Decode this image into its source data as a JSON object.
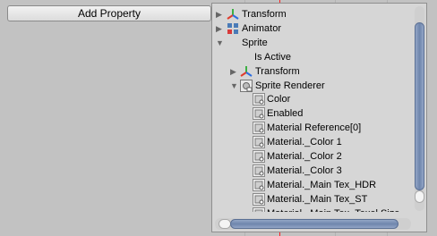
{
  "add_property_label": "Add Property",
  "colors": {
    "timeline_marker": "#ff2020",
    "scrollbar_thumb": "#6f86ad"
  },
  "tree": [
    {
      "label": "Transform",
      "icon": "transform-icon",
      "expand": "collapsed"
    },
    {
      "label": "Animator",
      "icon": "animator-icon",
      "expand": "collapsed"
    },
    {
      "label": "Sprite",
      "icon": "",
      "expand": "expanded"
    },
    {
      "label": "Is Active",
      "icon": "",
      "expand": "none"
    },
    {
      "label": "Transform",
      "icon": "transform-icon",
      "expand": "collapsed"
    },
    {
      "label": "Sprite Renderer",
      "icon": "sprite-renderer-icon",
      "expand": "expanded"
    },
    {
      "label": "Color",
      "icon": "property-icon",
      "expand": "none"
    },
    {
      "label": "Enabled",
      "icon": "property-icon",
      "expand": "none"
    },
    {
      "label": "Material Reference[0]",
      "icon": "property-icon",
      "expand": "none"
    },
    {
      "label": "Material._Color 1",
      "icon": "property-icon",
      "expand": "none"
    },
    {
      "label": "Material._Color 2",
      "icon": "property-icon",
      "expand": "none"
    },
    {
      "label": "Material._Color 3",
      "icon": "property-icon",
      "expand": "none"
    },
    {
      "label": "Material._Main Tex_HDR",
      "icon": "property-icon",
      "expand": "none"
    },
    {
      "label": "Material._Main Tex_ST",
      "icon": "property-icon",
      "expand": "none"
    },
    {
      "label": "Material._Main Tex_Texel Size",
      "icon": "property-icon",
      "expand": "none"
    }
  ]
}
